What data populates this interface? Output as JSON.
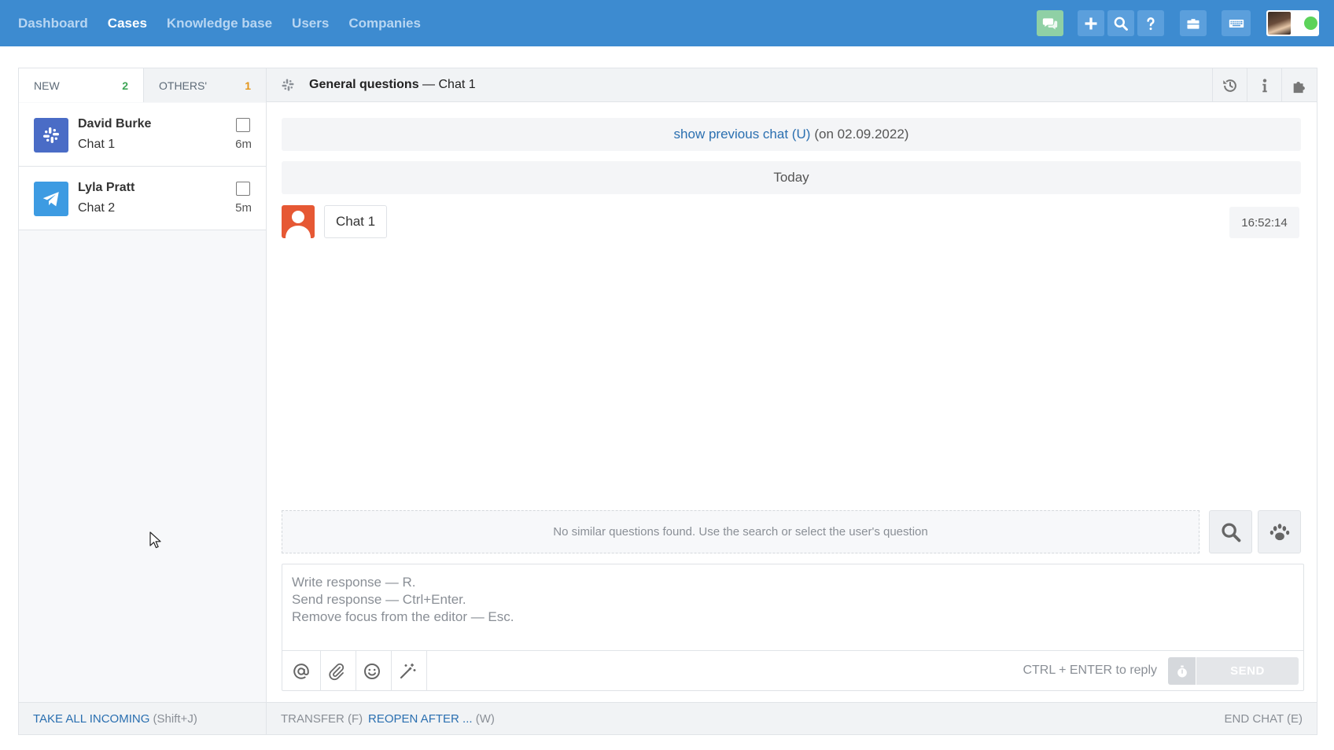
{
  "nav": {
    "items": [
      {
        "label": "Dashboard",
        "active": false
      },
      {
        "label": "Cases",
        "active": true
      },
      {
        "label": "Knowledge base",
        "active": false
      },
      {
        "label": "Users",
        "active": false
      },
      {
        "label": "Companies",
        "active": false
      }
    ],
    "icons": [
      "chat-icon",
      "plus-icon",
      "search-icon",
      "help-icon",
      "briefcase-icon",
      "keyboard-icon"
    ],
    "status_color": "#5cd35a",
    "bar_color": "#3d8bd0"
  },
  "tabs": {
    "new_label": "NEW",
    "new_count": "2",
    "others_label": "OTHERS'",
    "others_count": "1"
  },
  "chats": [
    {
      "name": "David Burke",
      "subtitle": "Chat 1",
      "age": "6m",
      "channel": "slack-icon"
    },
    {
      "name": "Lyla Pratt",
      "subtitle": "Chat 2",
      "age": "5m",
      "channel": "telegram-icon"
    }
  ],
  "conversation": {
    "group": "General questions",
    "separator": "—",
    "chat_name": "Chat 1",
    "prev_link": "show previous chat (U)",
    "prev_date": "(on 02.09.2022)",
    "day_label": "Today",
    "message": "Chat 1",
    "message_time": "16:52:14"
  },
  "suggest": {
    "text": "No similar questions found. Use the search or select the user's question"
  },
  "editor": {
    "placeholder": "Write response — R.\nSend response — Ctrl+Enter.\nRemove focus from the editor — Esc.",
    "hint": "CTRL + ENTER to reply",
    "send_label": "SEND"
  },
  "footer": {
    "take_all": "TAKE ALL INCOMING",
    "take_all_key": "(Shift+J)",
    "transfer": "TRANSFER (F)",
    "reopen": "REOPEN AFTER ...",
    "reopen_key": "(W)",
    "end": "END CHAT (E)"
  }
}
